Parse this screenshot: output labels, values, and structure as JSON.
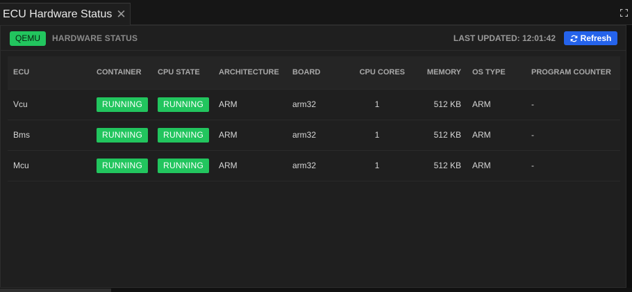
{
  "tab": {
    "title": "ECU Hardware Status",
    "close_glyph": "✕"
  },
  "header": {
    "badge": "QEMU",
    "title": "HARDWARE STATUS",
    "last_updated": "LAST UPDATED: 12:01:42",
    "refresh_label": "Refresh"
  },
  "table": {
    "columns": [
      "ECU",
      "CONTAINER",
      "CPU STATE",
      "ARCHITECTURE",
      "BOARD",
      "CPU CORES",
      "MEMORY",
      "OS TYPE",
      "PROGRAM COUNTER"
    ],
    "rows": [
      {
        "ecu": "Vcu",
        "container": "RUNNING",
        "cpu_state": "RUNNING",
        "architecture": "ARM",
        "board": "arm32",
        "cpu_cores": "1",
        "memory": "512 KB",
        "os_type": "ARM",
        "program_counter": "-"
      },
      {
        "ecu": "Bms",
        "container": "RUNNING",
        "cpu_state": "RUNNING",
        "architecture": "ARM",
        "board": "arm32",
        "cpu_cores": "1",
        "memory": "512 KB",
        "os_type": "ARM",
        "program_counter": "-"
      },
      {
        "ecu": "Mcu",
        "container": "RUNNING",
        "cpu_state": "RUNNING",
        "architecture": "ARM",
        "board": "arm32",
        "cpu_cores": "1",
        "memory": "512 KB",
        "os_type": "ARM",
        "program_counter": "-"
      }
    ]
  },
  "icons": {
    "maximize": "maximize-icon",
    "refresh": "refresh-icon",
    "close": "close-icon"
  },
  "colors": {
    "accent_green": "#22c55e",
    "accent_blue": "#2563eb",
    "panel_bg": "#1f1f1f",
    "header_row_bg": "#252525"
  }
}
